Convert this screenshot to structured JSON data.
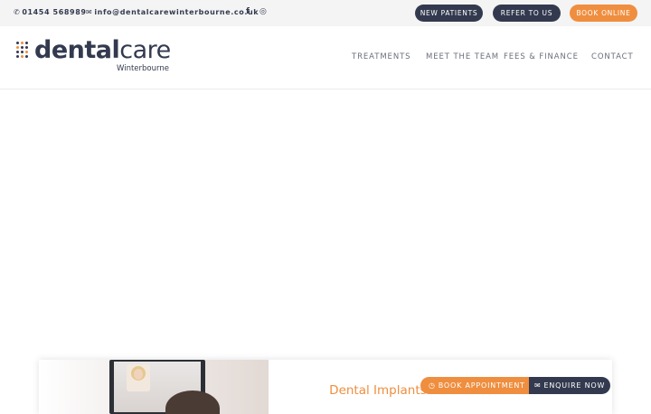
{
  "topbar": {
    "phone": "01454 568989",
    "email": "info@dentalcarewinterbourne.co.uk",
    "icons": {
      "phone": "phone-icon",
      "email": "envelope-icon",
      "facebook": "facebook-icon",
      "instagram": "instagram-icon"
    },
    "facebook_glyph": "f",
    "instagram_glyph": "◎",
    "buttons": {
      "new_patients": "NEW PATIENTS",
      "refer": "REFER TO US",
      "book_online": "BOOK ONLINE"
    }
  },
  "header": {
    "logo_text_bold": "dental",
    "logo_text_light": "care",
    "logo_sub": "Winterbourne",
    "nav": [
      "TREATMENTS",
      "MEET THE TEAM",
      "FEES & FINANCE",
      "CONTACT"
    ]
  },
  "card": {
    "title": "Dental Implants virtual consultation!"
  },
  "floating": {
    "book_appointment": "BOOK APPOINTMENT",
    "enquire_now": "ENQUIRE NOW",
    "book_icon": "clock-icon",
    "enquire_icon": "envelope-icon"
  },
  "colors": {
    "navy": "#333a4f",
    "orange": "#ef8e3f",
    "topbar_bg": "#f4f4f4"
  }
}
